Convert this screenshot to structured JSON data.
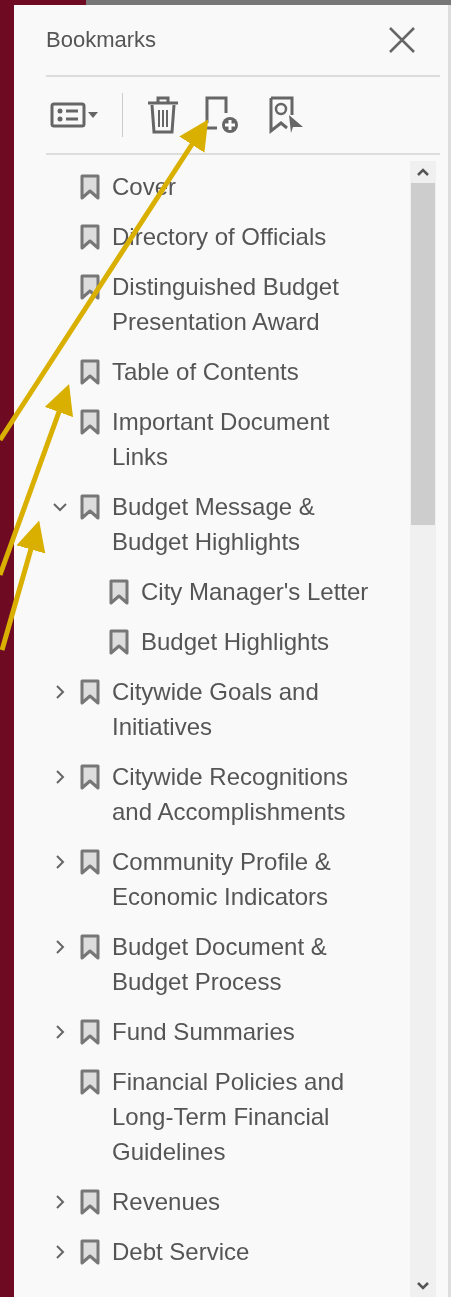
{
  "panel": {
    "title": "Bookmarks"
  },
  "bookmarks": [
    {
      "kind": "leaf",
      "label": "Cover"
    },
    {
      "kind": "leaf",
      "label": "Directory of Officials"
    },
    {
      "kind": "leaf",
      "label": "Distinguished Budget Presentation Award"
    },
    {
      "kind": "leaf",
      "label": "Table of Contents"
    },
    {
      "kind": "leaf",
      "label": "Important Document Links"
    },
    {
      "kind": "branch",
      "expanded": true,
      "label": "Budget Message & Budget Highlights",
      "children": [
        {
          "kind": "leaf",
          "label": "City Manager's Letter"
        },
        {
          "kind": "leaf",
          "label": "Budget Highlights"
        }
      ]
    },
    {
      "kind": "branch",
      "expanded": false,
      "label": "Citywide Goals and Initiatives"
    },
    {
      "kind": "branch",
      "expanded": false,
      "label": "Citywide Recognitions and Accomplishments"
    },
    {
      "kind": "branch",
      "expanded": false,
      "label": "Community Profile & Economic Indicators"
    },
    {
      "kind": "branch",
      "expanded": false,
      "label": "Budget Document & Budget Process"
    },
    {
      "kind": "branch",
      "expanded": false,
      "label": "Fund Summaries"
    },
    {
      "kind": "leaf",
      "label": "Financial Policies and Long-Term Financial Guidelines"
    },
    {
      "kind": "branch",
      "expanded": false,
      "label": "Revenues"
    },
    {
      "kind": "branch",
      "expanded": false,
      "label": "Debt Service"
    }
  ]
}
